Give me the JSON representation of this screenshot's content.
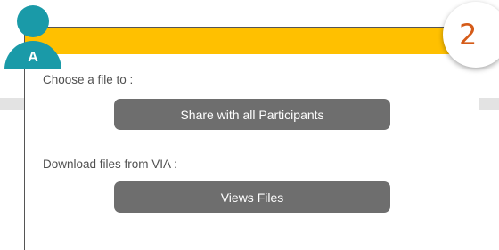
{
  "avatar": {
    "letter": "A",
    "color": "#1a9aa8"
  },
  "step_badge": {
    "number": "2",
    "color": "#d55b18"
  },
  "panel": {
    "header_color": "#ffc000",
    "share_prompt": "Choose a file to :",
    "share_button": "Share with all Participants",
    "download_prompt": "Download files from VIA :",
    "download_button": "Views Files",
    "button_color": "#6e6e6e"
  }
}
